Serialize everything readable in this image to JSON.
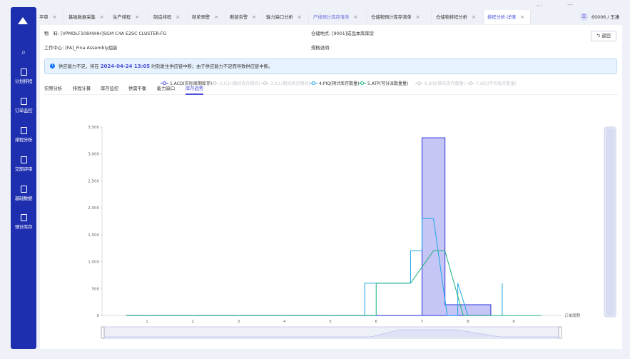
{
  "colors": {
    "sidebar": "#1d2fae",
    "accent": "#4b50d9",
    "alert_bg": "#e6f2fd",
    "series1": "#4a4fe0",
    "series4": "#1ea7e8",
    "series5": "#19b07a",
    "bar_fill": "#c7c8f5"
  },
  "sidebar": {
    "logo_icon": "triangle-logo",
    "search_icon": "search-icon",
    "items": [
      {
        "label": "计划排程",
        "icon": "doc-icon"
      },
      {
        "label": "订单监控",
        "icon": "monitor-icon"
      },
      {
        "label": "排程分析",
        "icon": "chart-icon"
      },
      {
        "label": "交期评审",
        "icon": "calendar-check-icon"
      },
      {
        "label": "基础数据",
        "icon": "database-icon"
      },
      {
        "label": "预计库存",
        "icon": "box-icon"
      }
    ]
  },
  "tabs": [
    {
      "label": "平审"
    },
    {
      "label": "基础数据采集"
    },
    {
      "label": "生产排程"
    },
    {
      "label": "制造排程"
    },
    {
      "label": "频单预警"
    },
    {
      "label": "断链告警"
    },
    {
      "label": "输力缺口分析"
    },
    {
      "label": "产线预计库存清单"
    },
    {
      "label": "仓储物预计库存清单"
    },
    {
      "label": "仓储物排程分析"
    },
    {
      "label": "排程分析-详情"
    }
  ],
  "tab_more": "···",
  "window_min": "—",
  "user": {
    "avatar": "王",
    "name": "60006 / 王凄"
  },
  "info": {
    "material_key": "物　料:",
    "material_value": "[VPMDLF10849HH]SGM C4A E2SC CLUSTER-FG",
    "warehouse_key": "仓储地点:",
    "warehouse_value": "[9001]成品本库库房",
    "workcenter_key": "工作中心:",
    "workcenter_value": "[FA]_Fina Assembly组装",
    "spec_key": "规格说明:",
    "spec_value": ""
  },
  "return_button": "返回",
  "alert": {
    "icon": "info-icon",
    "prefix": "供应能力不足，将在",
    "date": "2024-04-24 13:05",
    "suffix": "时刻发生供应链中断；由于供应能力不足而导致供应链中断。"
  },
  "subtabs": [
    "实際分析",
    "排程计算",
    "库存监控",
    "供需平衡",
    "能力缺口",
    "库存趋势"
  ],
  "subtab_active": 5,
  "chart_data": {
    "type": "line",
    "x_categories": [
      "1",
      "2",
      "3",
      "4",
      "5",
      "6",
      "7",
      "8",
      "9"
    ],
    "xlabel": "订单周期",
    "y_ticks": [
      "0",
      "500",
      "1,000",
      "1,500",
      "2,000",
      "2,500",
      "3,000",
      "3,500"
    ],
    "ylim": [
      0,
      3500
    ],
    "grid": false,
    "legend_position": "top",
    "legend": [
      {
        "name": "1.ACD(实际周期库存)",
        "color": "#4a4fe0",
        "active": true
      },
      {
        "name": "2.ICH(期间库存期间)",
        "color": "#bfc3cc",
        "active": false
      },
      {
        "name": "3.ICL(期间库存期间)",
        "color": "#bfc3cc",
        "active": false
      },
      {
        "name": "4.PIQ(预计库存数量)",
        "color": "#1ea7e8",
        "active": true
      },
      {
        "name": "5.ATP(可分派数量量)",
        "color": "#19b07a",
        "active": true
      },
      {
        "name": "6.BIQ(期末库存数量)",
        "color": "#bfc3cc",
        "active": false
      },
      {
        "name": "7.AIQ(平均库存数量)",
        "color": "#bfc3cc",
        "active": false
      }
    ],
    "series": [
      {
        "name": "1.ACD(实际周期库存)",
        "points": [
          [
            0.55,
            0
          ],
          [
            7.0,
            0
          ],
          [
            7.0,
            3300
          ],
          [
            7.5,
            3300
          ],
          [
            7.5,
            200
          ],
          [
            8.5,
            200
          ],
          [
            8.5,
            0
          ]
        ]
      },
      {
        "name": "4.PIQ(预计库存数量)",
        "points": [
          [
            0.55,
            0
          ],
          [
            5.75,
            0
          ],
          [
            5.75,
            600
          ],
          [
            6.0,
            600
          ],
          [
            6.0,
            600
          ],
          [
            6.75,
            600
          ],
          [
            6.75,
            1200
          ],
          [
            7.0,
            1200
          ],
          [
            7.0,
            1800
          ],
          [
            7.25,
            1800
          ],
          [
            7.55,
            0
          ],
          [
            7.78,
            0
          ],
          [
            7.78,
            600
          ],
          [
            8.0,
            0
          ],
          [
            8.75,
            0
          ],
          [
            8.75,
            600
          ],
          [
            8.75,
            0
          ]
        ]
      },
      {
        "name": "5.ATP(可分派数量量)",
        "points": [
          [
            0.55,
            0
          ],
          [
            5.75,
            0
          ],
          [
            6.0,
            0
          ],
          [
            6.0,
            600
          ],
          [
            6.75,
            600
          ],
          [
            7.25,
            1200
          ],
          [
            7.5,
            1200
          ],
          [
            7.9,
            0
          ],
          [
            9.6,
            0
          ]
        ]
      }
    ]
  }
}
